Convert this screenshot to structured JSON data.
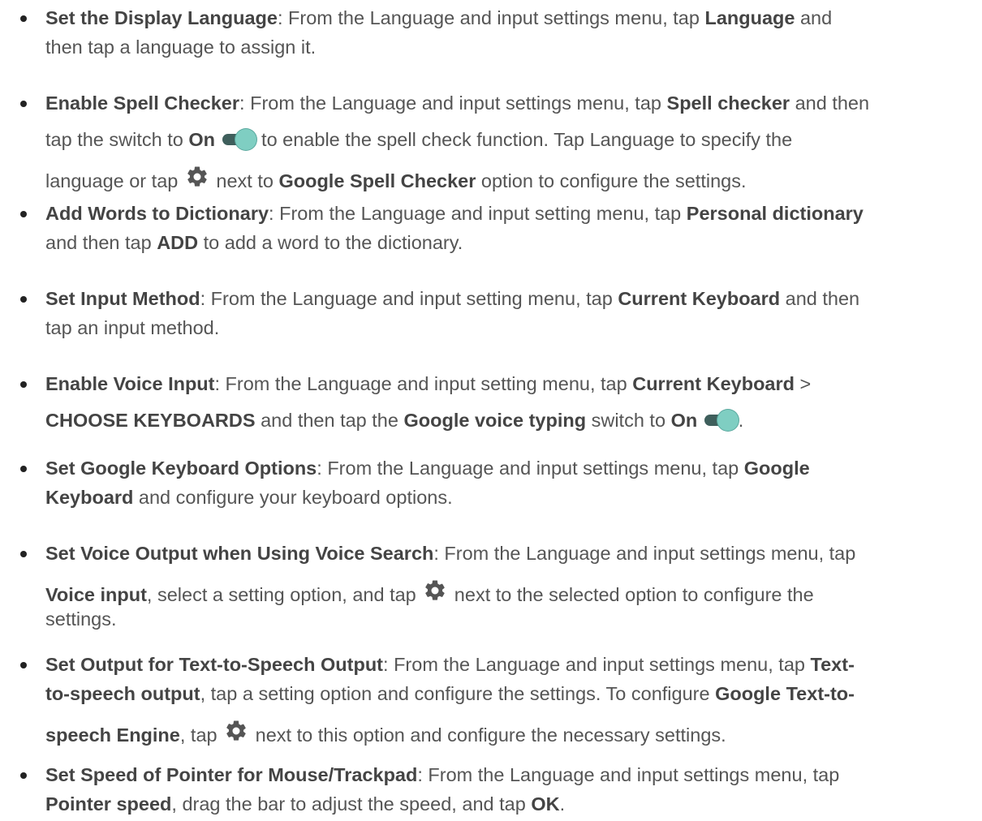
{
  "items": [
    {
      "lines": [
        [
          {
            "b": "Set the Display Language"
          },
          {
            "t": ": From the Language and input settings menu, tap "
          },
          {
            "b": "Language"
          },
          {
            "t": " and"
          }
        ],
        [
          {
            "t": "then tap a language to assign it."
          }
        ]
      ]
    },
    {
      "lines": [
        [
          {
            "b": "Enable Spell Checker"
          },
          {
            "t": ": From the Language and input settings menu, tap "
          },
          {
            "b": "Spell checker"
          },
          {
            "t": " and then"
          }
        ],
        [
          {
            "t": "tap the switch to "
          },
          {
            "b": "On"
          },
          {
            "t": " "
          },
          {
            "icon": "toggle"
          },
          {
            "t": " to enable the spell check function. Tap Language to specify the"
          }
        ],
        [
          {
            "t": "language or tap "
          },
          {
            "icon": "gear"
          },
          {
            "t": " next to "
          },
          {
            "b": "Google Spell Checker"
          },
          {
            "t": " option to configure the settings."
          }
        ]
      ]
    },
    {
      "lines": [
        [
          {
            "b": "Add Words to Dictionary"
          },
          {
            "t": ": From the Language and input setting menu, tap "
          },
          {
            "b": "Personal dictionary"
          }
        ],
        [
          {
            "t": "and then tap "
          },
          {
            "b": "ADD"
          },
          {
            "t": " to add a word to the dictionary."
          }
        ]
      ]
    },
    {
      "lines": [
        [
          {
            "b": "Set Input Method"
          },
          {
            "t": ": From the Language and input setting menu, tap "
          },
          {
            "b": "Current Keyboard"
          },
          {
            "t": " and then"
          }
        ],
        [
          {
            "t": "tap an input method."
          }
        ]
      ]
    },
    {
      "lines": [
        [
          {
            "b": "Enable Voice Input"
          },
          {
            "t": ": From the Language and input setting menu, tap "
          },
          {
            "b": "Current Keyboard"
          },
          {
            "t": " >"
          }
        ],
        [
          {
            "b": "CHOOSE KEYBOARDS"
          },
          {
            "t": " and then tap the "
          },
          {
            "b": "Google voice typing"
          },
          {
            "t": " switch to "
          },
          {
            "b": "On"
          },
          {
            "t": " "
          },
          {
            "icon": "toggle"
          },
          {
            "t": "."
          }
        ]
      ]
    },
    {
      "lines": [
        [
          {
            "b": "Set Google Keyboard Options"
          },
          {
            "t": ": From the Language and input settings menu, tap "
          },
          {
            "b": "Google"
          }
        ],
        [
          {
            "b": "Keyboard"
          },
          {
            "t": " and configure your keyboard options."
          }
        ]
      ]
    },
    {
      "lines": [
        [
          {
            "b": "Set Voice Output when Using Voice Search"
          },
          {
            "t": ": From the Language and input settings menu, tap"
          }
        ],
        [
          {
            "b": "Voice input"
          },
          {
            "t": ", select a setting option, and tap "
          },
          {
            "icon": "gear"
          },
          {
            "t": " next to the selected option to configure the"
          }
        ],
        [
          {
            "t": "settings."
          }
        ]
      ]
    },
    {
      "lines": [
        [
          {
            "b": "Set Output for Text-to-Speech Output"
          },
          {
            "t": ": From the Language and input settings menu, tap "
          },
          {
            "b": "Text-"
          }
        ],
        [
          {
            "b": "to-speech output"
          },
          {
            "t": ", tap a setting option and configure the settings. To configure "
          },
          {
            "b": "Google Text-to-"
          }
        ],
        [
          {
            "b": "speech Engine"
          },
          {
            "t": ", tap "
          },
          {
            "icon": "gear"
          },
          {
            "t": " next to this option and configure the necessary settings."
          }
        ]
      ]
    },
    {
      "lines": [
        [
          {
            "b": "Set Speed of Pointer for Mouse/Trackpad"
          },
          {
            "t": ": From the Language and input settings menu, tap"
          }
        ],
        [
          {
            "b": "Pointer speed"
          },
          {
            "t": ", drag the bar to adjust the speed, and tap "
          },
          {
            "b": "OK"
          },
          {
            "t": "."
          }
        ]
      ]
    }
  ],
  "colors": {
    "text": "#555555",
    "bold": "#444444",
    "toggle_track": "#3f5f5c",
    "toggle_knob": "#7fcec2",
    "gear": "#555555"
  },
  "icons": {
    "toggle": "toggle-switch-on-icon",
    "gear": "gear-icon"
  }
}
